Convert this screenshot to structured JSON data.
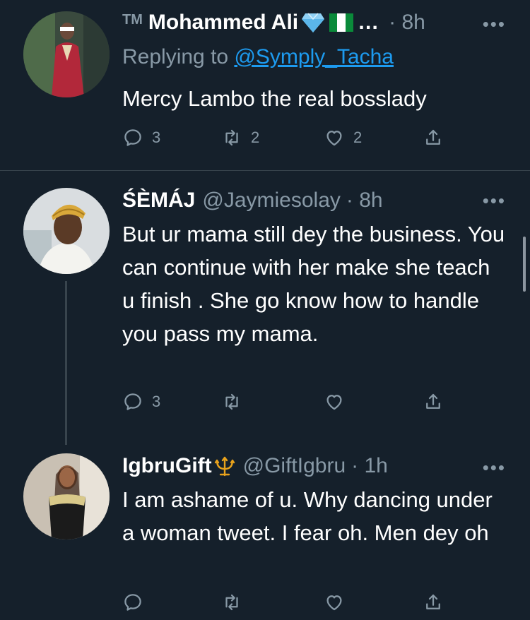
{
  "tweets": [
    {
      "tm": "TM",
      "name": "Mohammed Ali",
      "name_suffix": "…",
      "time": "· 8h",
      "replying_prefix": "Replying to",
      "replying_to": "@Symply_Tacha",
      "text": "Mercy Lambo the real bosslady",
      "reply_count": "3",
      "retweet_count": "2",
      "like_count": "2"
    },
    {
      "name": "ŚÈMÁJ",
      "handle": "@Jaymiesolay",
      "time": "· 8h",
      "text": "But ur mama still dey the business.  You can continue with her make she teach u finish . She go know how to handle you pass my mama.",
      "reply_count": "3",
      "retweet_count": "",
      "like_count": ""
    },
    {
      "name": "IgbruGift",
      "handle": "@GiftIgbru",
      "time": "· 1h",
      "text": "I am ashame of u. Why dancing under a woman tweet. I fear oh. Men dey oh",
      "reply_count": "",
      "retweet_count": "",
      "like_count": ""
    }
  ],
  "colors": {
    "background": "#15202b",
    "muted": "#8899a6",
    "link": "#1d9bf0",
    "divider": "#38444d"
  },
  "icons": [
    "reply-icon",
    "retweet-icon",
    "like-icon",
    "share-icon",
    "more-icon",
    "diamond-icon",
    "nigeria-flag-icon",
    "trident-icon"
  ]
}
